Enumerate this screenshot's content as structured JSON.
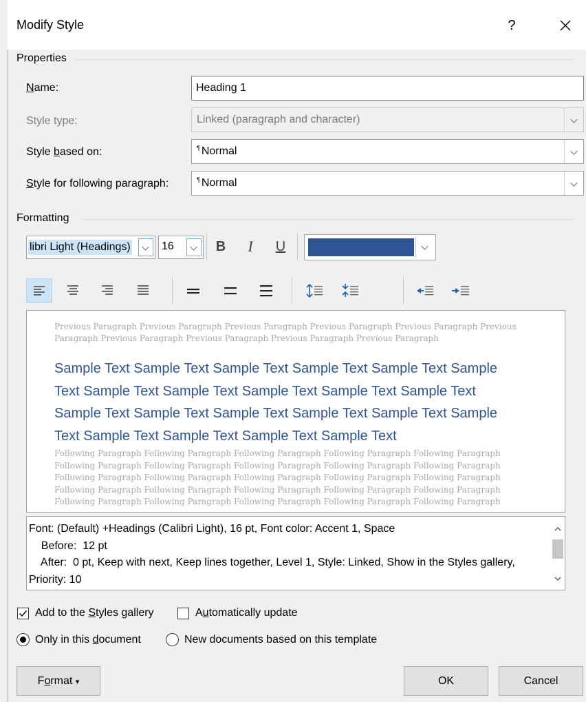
{
  "dialog": {
    "title": "Modify Style",
    "help_symbol": "?",
    "close_symbol": "✕"
  },
  "properties": {
    "heading": "Properties",
    "name_label_pre": "",
    "name_label_accel": "N",
    "name_label_post": "ame:",
    "name_value": "Heading 1",
    "style_type_label": "Style type:",
    "style_type_value": "Linked (paragraph and character)",
    "based_on_label_pre": "Style ",
    "based_on_label_accel": "b",
    "based_on_label_post": "ased on:",
    "based_on_value": "Normal",
    "following_label_pre": "",
    "following_label_accel": "S",
    "following_label_post": "tyle for following paragraph:",
    "following_value": "Normal",
    "pilcrow": "¶"
  },
  "formatting": {
    "heading": "Formatting",
    "font_name": "libri Light (Headings)",
    "font_size": "16",
    "bold": "B",
    "italic": "I",
    "underline": "U",
    "font_color": "#2f5496",
    "icons": [
      "align-left-icon",
      "align-center-icon",
      "align-right-icon",
      "justify-icon",
      "single-spacing-icon",
      "one-half-spacing-icon",
      "double-spacing-icon",
      "increase-paragraph-spacing-icon",
      "decrease-paragraph-spacing-icon",
      "decrease-indent-icon",
      "increase-indent-icon"
    ]
  },
  "preview": {
    "previous_lines": [
      "Previous Paragraph Previous Paragraph Previous Paragraph Previous Paragraph Previous Paragraph Previous",
      "Paragraph Previous Paragraph Previous Paragraph Previous Paragraph Previous Paragraph"
    ],
    "sample_lines": [
      "Sample Text Sample Text Sample Text Sample Text Sample Text Sample",
      "Text Sample Text Sample Text Sample Text Sample Text Sample Text",
      "Sample Text Sample Text Sample Text Sample Text Sample Text Sample",
      "Text Sample Text Sample Text Sample Text Sample Text"
    ],
    "following_lines": [
      "Following Paragraph Following Paragraph Following Paragraph Following Paragraph Following Paragraph",
      "Following Paragraph Following Paragraph Following Paragraph Following Paragraph Following Paragraph",
      "Following Paragraph Following Paragraph Following Paragraph Following Paragraph Following Paragraph",
      "Following Paragraph Following Paragraph Following Paragraph Following Paragraph Following Paragraph",
      "Following Paragraph Following Paragraph Following Paragraph Following Paragraph Following Paragraph"
    ]
  },
  "description": {
    "lines": [
      "Font: (Default) +Headings (Calibri Light), 16 pt, Font color: Accent 1, Space",
      "    Before:  12 pt",
      "    After:  0 pt, Keep with next, Keep lines together, Level 1, Style: Linked, Show in the Styles gallery,",
      "Priority: 10"
    ]
  },
  "options": {
    "add_gallery_pre": "Add to the ",
    "add_gallery_accel": "S",
    "add_gallery_post": "tyles gallery",
    "add_gallery_checked": true,
    "auto_update_pre": "A",
    "auto_update_accel": "u",
    "auto_update_post": "tomatically update",
    "auto_update_checked": false,
    "only_doc_pre": "Only in this ",
    "only_doc_accel": "d",
    "only_doc_post": "ocument",
    "only_doc_selected": true,
    "new_docs_label": "New documents based on this template",
    "new_docs_selected": false
  },
  "buttons": {
    "format_pre": "F",
    "format_accel": "o",
    "format_post": "rmat",
    "format_arrow": "▾",
    "ok": "OK",
    "cancel": "Cancel"
  }
}
